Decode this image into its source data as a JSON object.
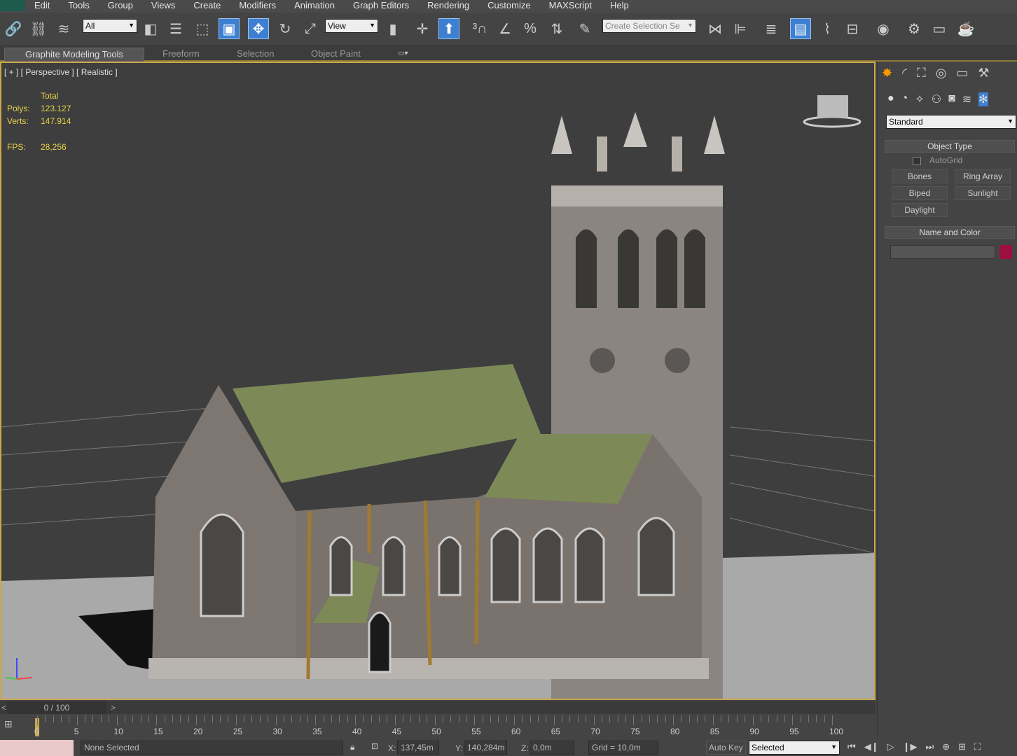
{
  "menu": [
    "Edit",
    "Tools",
    "Group",
    "Views",
    "Create",
    "Modifiers",
    "Animation",
    "Graph Editors",
    "Rendering",
    "Customize",
    "MAXScript",
    "Help"
  ],
  "toolbar": {
    "filter": "All",
    "ref_coord": "View",
    "named_selection": "Create Selection Se"
  },
  "ribbon": {
    "tabs": [
      "Graphite Modeling Tools",
      "Freeform",
      "Selection",
      "Object Paint"
    ]
  },
  "viewport": {
    "label": "[ + ] [ Perspective ] [ Realistic ]",
    "stats": {
      "header": "Total",
      "polys_label": "Polys:",
      "polys": "123.127",
      "verts_label": "Verts:",
      "verts": "147.914",
      "fps_label": "FPS:",
      "fps": "28,256"
    }
  },
  "command_panel": {
    "dropdown": "Standard",
    "object_type": {
      "title": "Object Type",
      "autogrid": "AutoGrid",
      "buttons": [
        "Bones",
        "Ring Array",
        "Biped",
        "Sunlight",
        "Daylight"
      ]
    },
    "name_color": {
      "title": "Name and Color",
      "name": "",
      "color": "#9b1040"
    }
  },
  "timeline": {
    "frame": "0 / 100",
    "ticks": [
      "0",
      "5",
      "10",
      "15",
      "20",
      "25",
      "30",
      "35",
      "40",
      "45",
      "50",
      "55",
      "60",
      "65",
      "70",
      "75",
      "80",
      "85",
      "90",
      "95",
      "100"
    ]
  },
  "status": {
    "selection": "None Selected",
    "x_label": "X:",
    "x": "137,45m",
    "y_label": "Y:",
    "y": "140,284m",
    "z_label": "Z:",
    "z": "0,0m",
    "grid": "Grid = 10,0m",
    "autokey": "Auto Key",
    "key_mode": "Selected"
  }
}
